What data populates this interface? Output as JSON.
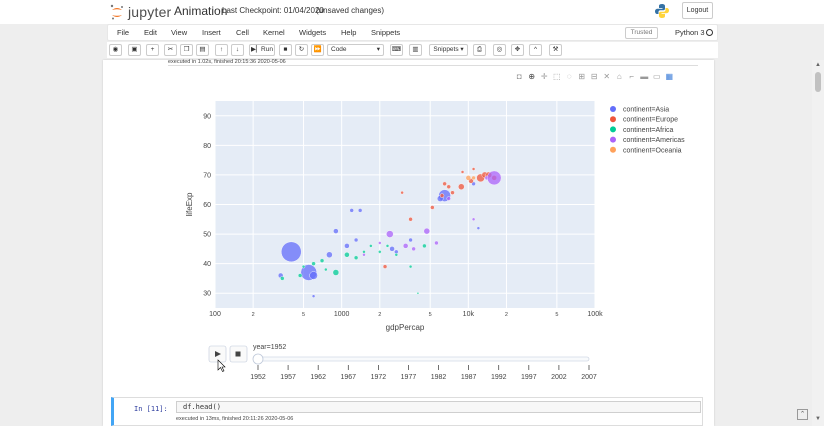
{
  "header": {
    "app_name": "jupyter",
    "notebook_name": "Animation",
    "checkpoint": "Last Checkpoint: 01/04/2020",
    "unsaved": "(unsaved changes)",
    "logout_label": "Logout"
  },
  "menubar": {
    "items": [
      "File",
      "Edit",
      "View",
      "Insert",
      "Cell",
      "Kernel",
      "Widgets",
      "Help",
      "Snippets"
    ],
    "trusted_label": "Trusted",
    "kernel_name": "Python 3"
  },
  "toolbar": {
    "run_label": "Run",
    "cell_type": "Code",
    "snippets_label": "Snippets"
  },
  "cell1": {
    "exec_info": "executed in 1.02s, finished 20:15:36 2020-05-06"
  },
  "cell2": {
    "prompt": "In [11]:",
    "code": "df.head()",
    "exec_info": "executed in 13ms, finished 20:11:26 2020-05-06"
  },
  "chart_data": {
    "type": "scatter",
    "title": "",
    "xlabel": "gdpPercap",
    "ylabel": "lifeExp",
    "x_scale": "log",
    "xlim": [
      100,
      100000
    ],
    "ylim": [
      25,
      95
    ],
    "x_ticks": [
      {
        "value": 100,
        "label": "100"
      },
      {
        "value": 200,
        "label": "2"
      },
      {
        "value": 500,
        "label": "5"
      },
      {
        "value": 1000,
        "label": "1000"
      },
      {
        "value": 2000,
        "label": "2"
      },
      {
        "value": 5000,
        "label": "5"
      },
      {
        "value": 10000,
        "label": "10k"
      },
      {
        "value": 20000,
        "label": "2"
      },
      {
        "value": 50000,
        "label": "5"
      },
      {
        "value": 100000,
        "label": "100k"
      }
    ],
    "y_ticks": [
      30,
      40,
      50,
      60,
      70,
      80,
      90
    ],
    "grid": true,
    "legend_position": "right",
    "series": [
      {
        "name": "continent=Asia",
        "color": "#636efa",
        "points": [
          [
            400,
            44,
            10
          ],
          [
            550,
            37,
            8
          ],
          [
            600,
            36,
            4
          ],
          [
            330,
            36,
            2.5
          ],
          [
            800,
            43,
            3
          ],
          [
            1100,
            46,
            2.5
          ],
          [
            900,
            51,
            2.5
          ],
          [
            1200,
            58,
            2
          ],
          [
            1400,
            58,
            2
          ],
          [
            2500,
            45,
            2.5
          ],
          [
            2700,
            44,
            2
          ],
          [
            3500,
            48,
            2
          ],
          [
            6500,
            63,
            6
          ],
          [
            6000,
            62,
            3
          ],
          [
            11000,
            67,
            2
          ],
          [
            12000,
            52,
            1.5
          ],
          [
            600,
            29,
            1.5
          ],
          [
            1300,
            48,
            2
          ]
        ]
      },
      {
        "name": "continent=Europe",
        "color": "#ef553b",
        "points": [
          [
            2200,
            39,
            2
          ],
          [
            3500,
            55,
            2
          ],
          [
            5200,
            59,
            2
          ],
          [
            6200,
            63,
            2
          ],
          [
            7000,
            66,
            2
          ],
          [
            8800,
            66,
            3
          ],
          [
            10500,
            68,
            2.5
          ],
          [
            12500,
            69,
            4
          ],
          [
            13500,
            70,
            3
          ],
          [
            14500,
            70,
            3
          ],
          [
            16000,
            69,
            2.5
          ],
          [
            11000,
            72,
            1.5
          ],
          [
            9000,
            71,
            1.5
          ],
          [
            6500,
            67,
            2
          ],
          [
            7500,
            64,
            2
          ],
          [
            3000,
            64,
            1.5
          ]
        ]
      },
      {
        "name": "continent=Africa",
        "color": "#00cc96",
        "points": [
          [
            340,
            35,
            2
          ],
          [
            470,
            36,
            2
          ],
          [
            600,
            40,
            2
          ],
          [
            700,
            41,
            2
          ],
          [
            900,
            37,
            3
          ],
          [
            1100,
            43,
            2.5
          ],
          [
            1300,
            42,
            2
          ],
          [
            1500,
            44,
            1.5
          ],
          [
            1700,
            46,
            1.5
          ],
          [
            2000,
            44,
            1.5
          ],
          [
            2300,
            46,
            1.5
          ],
          [
            2700,
            43,
            1.5
          ],
          [
            3500,
            39,
            1.5
          ],
          [
            4500,
            46,
            2
          ],
          [
            750,
            38,
            1.5
          ],
          [
            500,
            39,
            1.5
          ],
          [
            4000,
            30,
            1
          ]
        ]
      },
      {
        "name": "continent=Americas",
        "color": "#ab63fa",
        "points": [
          [
            2400,
            50,
            3.5
          ],
          [
            3200,
            46,
            2.5
          ],
          [
            3700,
            45,
            2
          ],
          [
            4700,
            51,
            3
          ],
          [
            5600,
            47,
            2
          ],
          [
            7000,
            62,
            2
          ],
          [
            14000,
            69,
            2
          ],
          [
            16000,
            69,
            7
          ],
          [
            11000,
            55,
            1.5
          ],
          [
            2000,
            47,
            1.5
          ],
          [
            1500,
            43,
            1.5
          ]
        ]
      },
      {
        "name": "continent=Oceania",
        "color": "#ffa15a",
        "points": [
          [
            10000,
            69,
            2.5
          ],
          [
            11000,
            69,
            2
          ]
        ]
      }
    ],
    "slider": {
      "current_label": "year=1952",
      "ticks": [
        "1952",
        "1957",
        "1962",
        "1967",
        "1972",
        "1977",
        "1982",
        "1987",
        "1992",
        "1997",
        "2002",
        "2007"
      ],
      "value": "1952"
    }
  }
}
